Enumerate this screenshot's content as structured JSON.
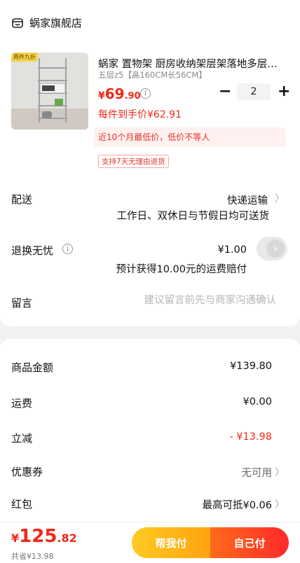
{
  "shop": {
    "name": "蜗家旗舰店",
    "icon": "shop-icon"
  },
  "product": {
    "image_tag": "两件九折",
    "title": "蜗家 置物架 厨房收纳架层架落地多层储物架",
    "spec": "五层z5【高160CM长56CM】",
    "price_currency": "¥",
    "price_int": "69",
    "price_dec": ".90",
    "info_icon": "i",
    "each_price": "每件到手价¥62.91",
    "low_price_note": "近10个月最低价，低价不等人",
    "return_tag": "支持7天无理由退货",
    "quantity": "2",
    "minus": "−",
    "plus": "+"
  },
  "delivery": {
    "label": "配送",
    "value": "快递运输",
    "sub": "工作日、双休日与节假日均可送货",
    "chevron": "〉"
  },
  "return_insurance": {
    "label": "退换无忧",
    "info_icon": "i",
    "value": "¥1.00",
    "sub": "预计获得10.00元的运费赔付",
    "toggle_icon": "›"
  },
  "message": {
    "label": "留言",
    "placeholder": "建议留言前先与商家沟通确认"
  },
  "summary": {
    "goods_label": "商品金额",
    "goods_value": "¥139.80",
    "shipping_label": "运费",
    "shipping_value": "¥0.00",
    "discount_label": "立减",
    "discount_value": "- ¥13.98",
    "coupon_label": "优惠券",
    "coupon_value": "无可用",
    "redpacket_label": "红包",
    "redpacket_value": "最高可抵¥0.06",
    "chevron": "〉"
  },
  "footer": {
    "total_currency": "¥",
    "total_int": "125",
    "total_dec": ".82",
    "saved": "共省¥13.98",
    "help_pay_label": "帮我付",
    "self_pay_label": "自己付"
  },
  "colors": {
    "accent_red": "#ee2a1b",
    "accent_yellow": "#ffb316",
    "price_red": "#e5332a"
  }
}
